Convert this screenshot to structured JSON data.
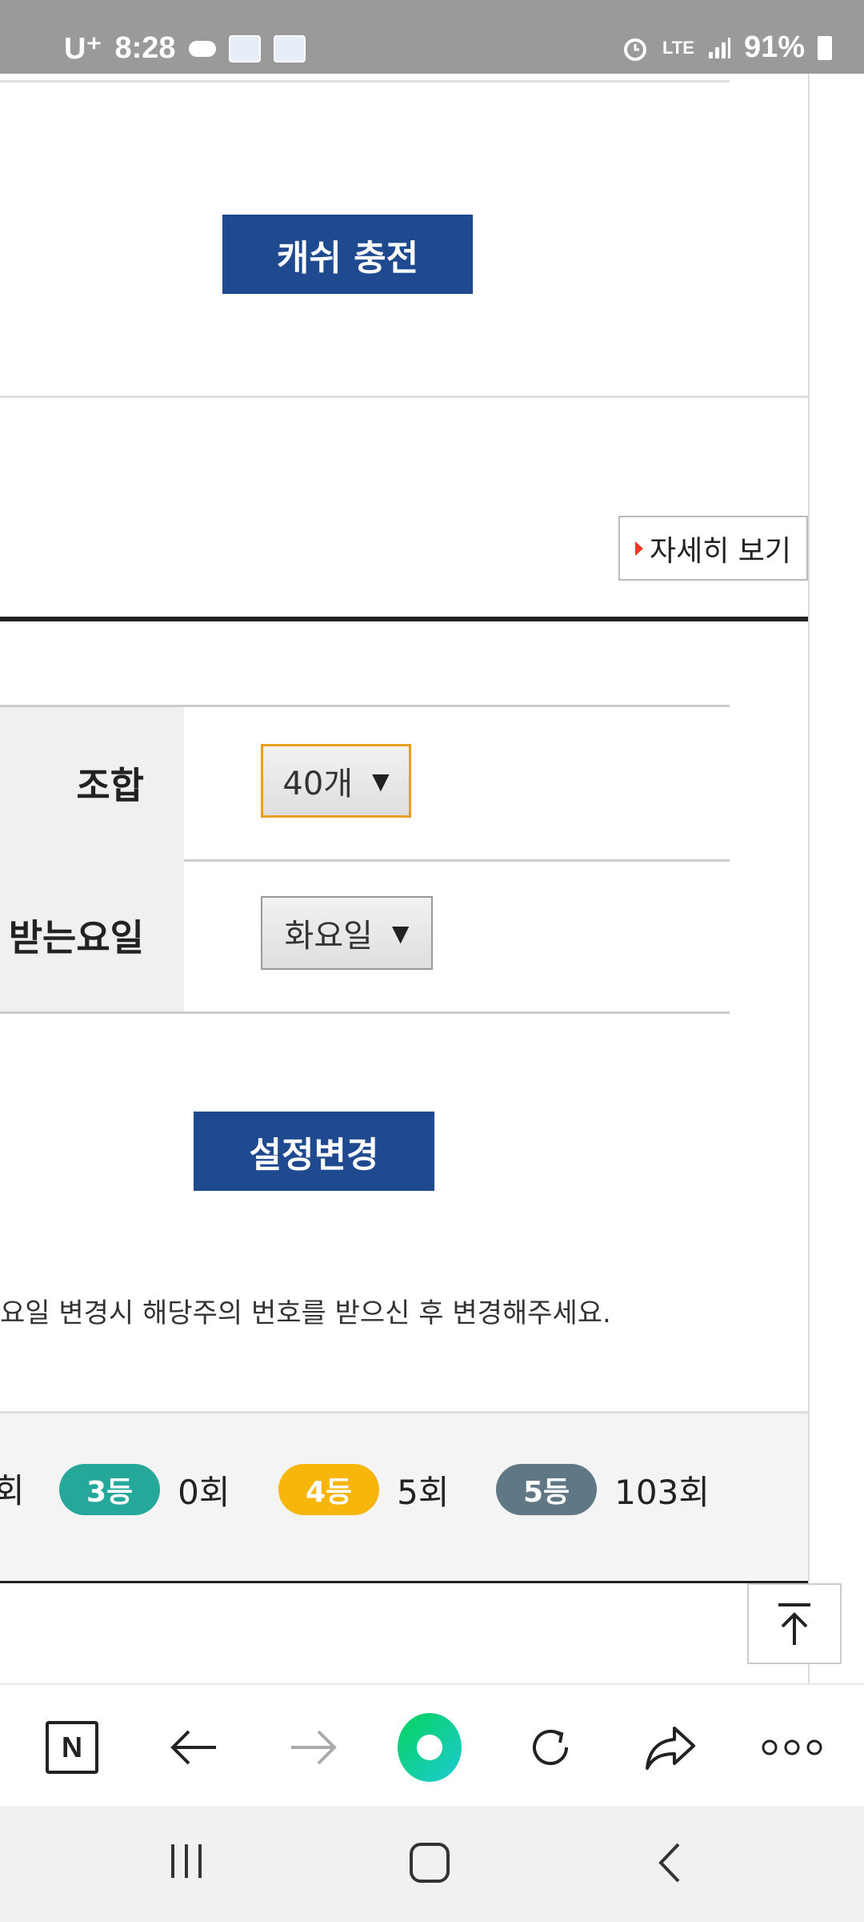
{
  "status_bar": {
    "carrier": "U⁺",
    "time": "8:28",
    "network": "LTE",
    "battery": "91%"
  },
  "cash_section": {
    "charge_button": "캐쉬 충전"
  },
  "detail_link": {
    "label": "자세히 보기"
  },
  "settings": {
    "rows": [
      {
        "label": "조합",
        "value": "40개"
      },
      {
        "label": "받는요일",
        "value": "화요일"
      }
    ],
    "submit_label": "설정변경",
    "notice": "요일 변경시 해당주의 번호를 받으신 후 변경해주세요."
  },
  "prize_summary": {
    "items": [
      {
        "badge": "3등",
        "count": "0회",
        "color": "#25a89a"
      },
      {
        "badge": "4등",
        "count": "5회",
        "color": "#f8b50c"
      },
      {
        "badge": "5등",
        "count": "103회",
        "color": "#607885"
      }
    ],
    "leading_suffix": "회"
  },
  "toolbar": {
    "n_label": "N",
    "icons": [
      "naver-n-icon",
      "back-arrow-icon",
      "forward-arrow-icon",
      "green-dot-icon",
      "refresh-icon",
      "share-icon",
      "more-icon"
    ]
  }
}
